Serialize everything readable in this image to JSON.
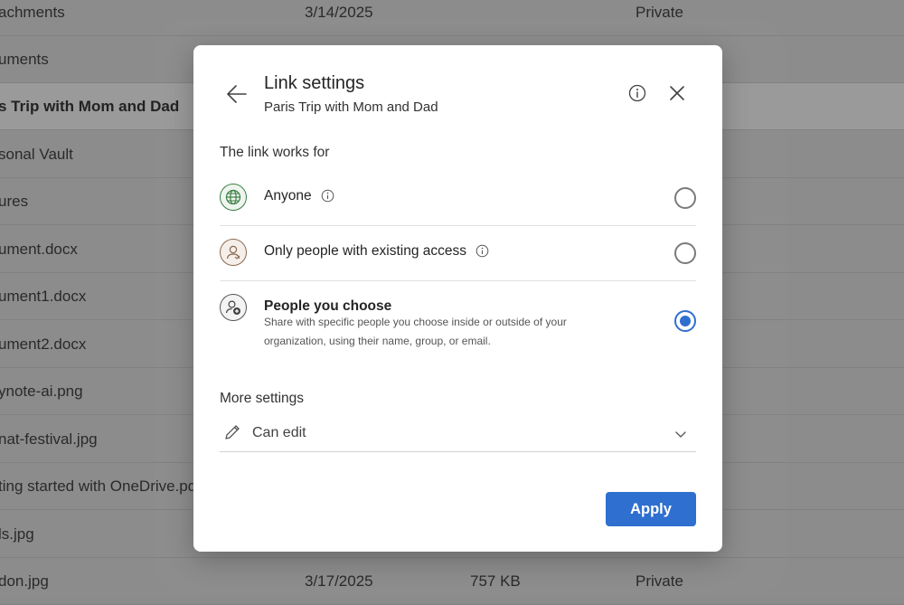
{
  "file_list": {
    "rows": [
      {
        "name": "achments",
        "date": "3/14/2025",
        "size": "",
        "sharing": "Private"
      },
      {
        "name": "uments",
        "date": "",
        "size": "",
        "sharing": ""
      },
      {
        "name": "s Trip with Mom and Dad",
        "date": "",
        "size": "",
        "sharing": ""
      },
      {
        "name": "sonal Vault",
        "date": "",
        "size": "",
        "sharing": ""
      },
      {
        "name": "ures",
        "date": "",
        "size": "",
        "sharing": ""
      },
      {
        "name": "ument.docx",
        "date": "",
        "size": "",
        "sharing": ""
      },
      {
        "name": "ument1.docx",
        "date": "",
        "size": "",
        "sharing": ""
      },
      {
        "name": "ument2.docx",
        "date": "",
        "size": "",
        "sharing": ""
      },
      {
        "name": "ynote-ai.png",
        "date": "",
        "size": "",
        "sharing": ""
      },
      {
        "name": "nat-festival.jpg",
        "date": "",
        "size": "",
        "sharing": ""
      },
      {
        "name": "ting started with OneDrive.pdf",
        "date": "",
        "size": "",
        "sharing": ""
      },
      {
        "name": "ls.jpg",
        "date": "",
        "size": "",
        "sharing": ""
      },
      {
        "name": "don.jpg",
        "date": "3/17/2025",
        "size": "757 KB",
        "sharing": "Private"
      }
    ]
  },
  "dialog": {
    "title": "Link settings",
    "subtitle": "Paris Trip with Mom and Dad",
    "link_works_for_label": "The link works for",
    "options": [
      {
        "label": "Anyone",
        "icon": "globe-icon",
        "selected": false
      },
      {
        "label": "Only people with existing access",
        "icon": "person-icon",
        "selected": false
      },
      {
        "label": "People you choose",
        "description": "Share with specific people you choose inside or outside of your organization, using their name, group, or email.",
        "icon": "person-add-icon",
        "selected": true
      }
    ],
    "more_settings_label": "More settings",
    "permission": {
      "value": "Can edit",
      "icon": "pencil-icon"
    },
    "apply_label": "Apply"
  },
  "colors": {
    "accent": "#2f6fcf",
    "anyone_icon": "#3a7d44",
    "existing_icon": "#8a6a52",
    "choose_icon": "#555555"
  }
}
